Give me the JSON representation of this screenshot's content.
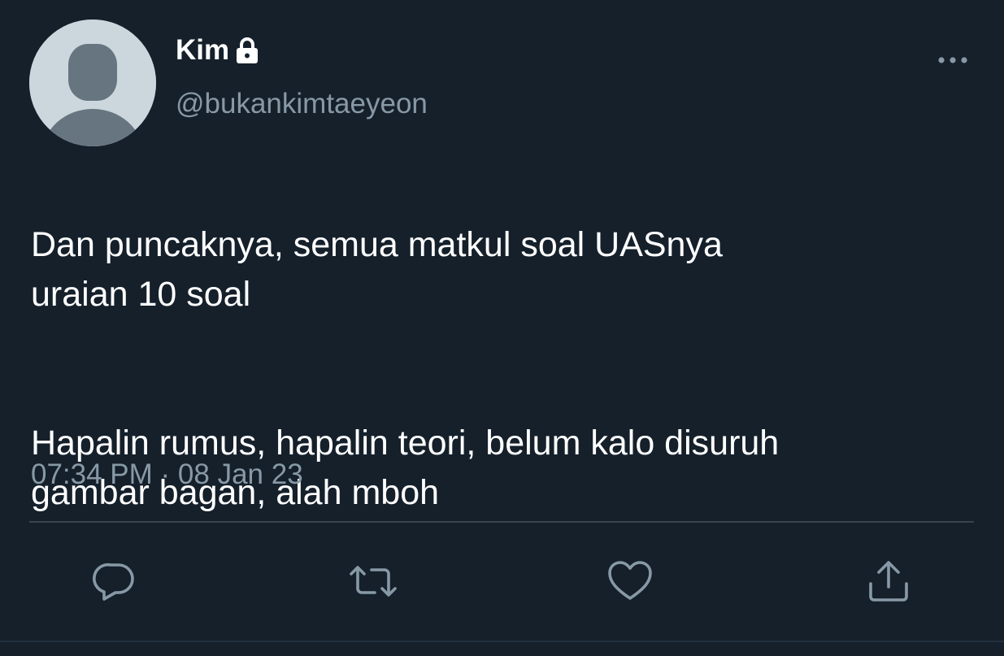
{
  "colors": {
    "background": "#15202b",
    "text_primary": "#ffffff",
    "text_secondary": "#8899a6",
    "icon": "#8899a6",
    "divider": "#38444d"
  },
  "author": {
    "display_name": "Kim",
    "handle": "@bukankimtaeyeon",
    "protected_icon": "lock-icon",
    "avatar_icon": "default-avatar-icon"
  },
  "tweet": {
    "paragraphs": [
      "Dan puncaknya, semua matkul soal UASnya\nuraian 10 soal",
      "Hapalin rumus, hapalin teori, belum kalo disuruh\ngambar bagan, alah mboh"
    ],
    "timestamp": "07:34 PM · 08 Jan 23"
  },
  "actions": [
    {
      "name": "reply",
      "icon": "reply-icon"
    },
    {
      "name": "retweet",
      "icon": "retweet-icon"
    },
    {
      "name": "like",
      "icon": "heart-icon"
    },
    {
      "name": "share",
      "icon": "share-icon"
    }
  ],
  "menu": {
    "icon": "more-icon"
  }
}
